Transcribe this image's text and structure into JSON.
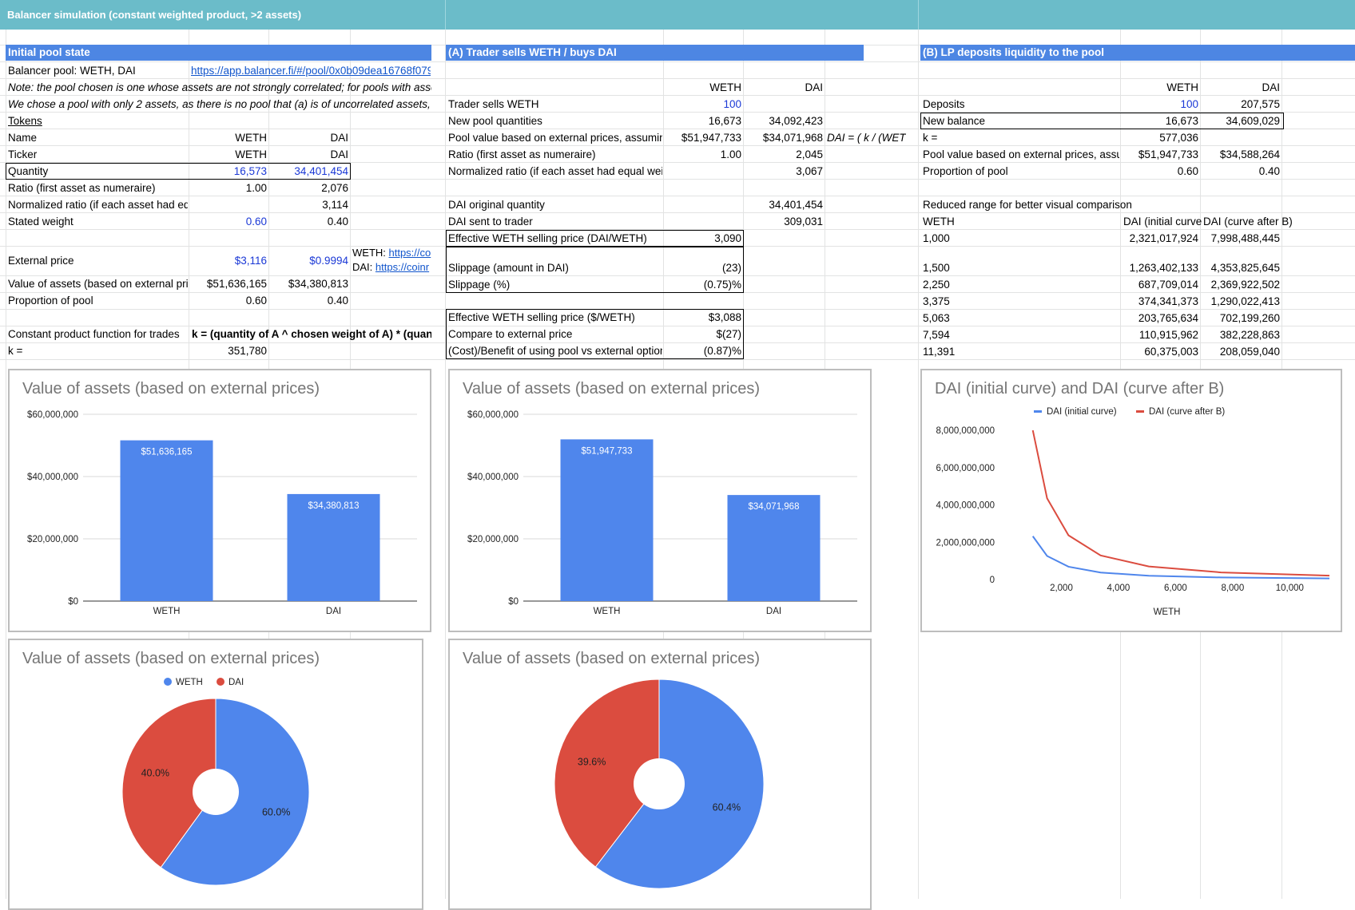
{
  "title": "Balancer simulation (constant weighted product, >2 assets)",
  "initial": {
    "header": "Initial pool state",
    "pool_label": "Balancer pool: WETH, DAI",
    "pool_link": "https://app.balancer.fi/#/pool/0x0b09dea16768f079",
    "note1": "Note: the pool chosen is one whose assets are not strongly correlated; for pools with asse",
    "note2": "We chose a pool with only 2 assets, as there is no pool that (a) is of uncorrelated assets, (",
    "tokens": "Tokens",
    "name_label": "Name",
    "name_a": "WETH",
    "name_b": "DAI",
    "ticker_label": "Ticker",
    "ticker_a": "WETH",
    "ticker_b": "DAI",
    "qty_label": "Quantity",
    "qty_a": "16,573",
    "qty_b": "34,401,454",
    "ratio_label": "Ratio (first asset as numeraire)",
    "ratio_a": "1.00",
    "ratio_b": "2,076",
    "norm_label": "Normalized ratio (if each asset had equ",
    "norm_b": "3,114",
    "weight_label": "Stated weight",
    "weight_a": "0.60",
    "weight_b": "0.40",
    "ext_label": "External price",
    "ext_a": "$3,116",
    "ext_b": "$0.9994",
    "ext_src_weth": "WETH: ",
    "ext_src_weth_link": "https://co",
    "ext_src_dai": "DAI: ",
    "ext_src_dai_link": "https://coinr",
    "value_label": "Value of assets (based on external pric",
    "value_a": "$51,636,165",
    "value_b": "$34,380,813",
    "prop_label": "Proportion of pool",
    "prop_a": "0.60",
    "prop_b": "0.40",
    "cpf_label": "Constant product function for trades",
    "cpf_formula": "k = (quantity of A ^ chosen weight of A) * (quan",
    "k_label": "k =",
    "k_value": "351,780"
  },
  "sectionA": {
    "header": "(A) Trader sells WETH / buys DAI",
    "col_a": "WETH",
    "col_b": "DAI",
    "sells_label": "Trader sells WETH",
    "sells_a": "100",
    "newq_label": "New pool quantities",
    "newq_a": "16,673",
    "newq_b": "34,092,423",
    "pv_label": "Pool value based on external prices, assumin",
    "pv_a": "$51,947,733",
    "pv_b": "$34,071,968",
    "pv_note": "DAI = ( k / (WET",
    "ratio_label": "Ratio (first asset as numeraire)",
    "ratio_a": "1.00",
    "ratio_b": "2,045",
    "norm_label": "Normalized ratio (if each asset had equal wei",
    "norm_b": "3,067",
    "dai_orig_label": "DAI original quantity",
    "dai_orig": "34,401,454",
    "dai_sent_label": "DAI sent to trader",
    "dai_sent": "309,031",
    "eff_label": "Effective WETH selling price (DAI/WETH)",
    "eff": "3,090",
    "slip_amt_label": "Slippage (amount in DAI)",
    "slip_amt": "(23)",
    "slip_pct_label": "Slippage (%)",
    "slip_pct": "(0.75)%",
    "eff_usd_label": "Effective WETH selling price ($/WETH)",
    "eff_usd": "$3,088",
    "cmp_label": "Compare to external price",
    "cmp": "$(27)",
    "cost_label": "(Cost)/Benefit of using pool vs external option",
    "cost": "(0.87)%"
  },
  "sectionB": {
    "header": "(B) LP deposits liquidity to the pool",
    "col_a": "WETH",
    "col_b": "DAI",
    "dep_label": "Deposits",
    "dep_a": "100",
    "dep_b": "207,575",
    "nb_label": "New balance",
    "nb_a": "16,673",
    "nb_b": "34,609,029",
    "k_label": "k =",
    "k_value": "577,036",
    "pv_label": "Pool value based on external prices, assu",
    "pv_a": "$51,947,733",
    "pv_b": "$34,588,264",
    "prop_label": "Proportion of pool",
    "prop_a": "0.60",
    "prop_b": "0.40",
    "range_label": "Reduced range for better visual comparison",
    "range_col_weth": "WETH",
    "range_col_init": "DAI (initial curve",
    "range_col_after": "DAI (curve after B)",
    "range_rows": [
      {
        "weth": "1,000",
        "init": "2,321,017,924",
        "after": "7,998,488,445"
      },
      {
        "weth": "1,500",
        "init": "1,263,402,133",
        "after": "4,353,825,645"
      },
      {
        "weth": "2,250",
        "init": "687,709,014",
        "after": "2,369,922,502"
      },
      {
        "weth": "3,375",
        "init": "374,341,373",
        "after": "1,290,022,413"
      },
      {
        "weth": "5,063",
        "init": "203,765,634",
        "after": "702,199,260"
      },
      {
        "weth": "7,594",
        "init": "110,915,962",
        "after": "382,228,863"
      },
      {
        "weth": "11,391",
        "init": "60,375,003",
        "after": "208,059,040"
      }
    ]
  },
  "colors": {
    "weth": "#4f86ec",
    "dai": "#db4c3f",
    "header": "#4d86e3",
    "title_bar": "#6bbcc9"
  },
  "chart_data": [
    {
      "type": "bar",
      "title": "Value of assets (based on external prices)",
      "categories": [
        "WETH",
        "DAI"
      ],
      "values": [
        51636165,
        34380813
      ],
      "labels": [
        "$51,636,165",
        "$34,380,813"
      ],
      "yticks": [
        "$60,000,000",
        "$40,000,000",
        "$20,000,000",
        "$0"
      ],
      "ylim": [
        0,
        60000000
      ]
    },
    {
      "type": "bar",
      "title": "Value of assets (based on external prices)",
      "categories": [
        "WETH",
        "DAI"
      ],
      "values": [
        51947733,
        34071968
      ],
      "labels": [
        "$51,947,733",
        "$34,071,968"
      ],
      "yticks": [
        "$60,000,000",
        "$40,000,000",
        "$20,000,000",
        "$0"
      ],
      "ylim": [
        0,
        60000000
      ]
    },
    {
      "type": "line",
      "title": "DAI (initial curve) and DAI (curve after B)",
      "xlabel": "WETH",
      "x": [
        1000,
        1500,
        2250,
        3375,
        5063,
        7594,
        11391
      ],
      "series": [
        {
          "name": "DAI (initial curve)",
          "values": [
            2321017924,
            1263402133,
            687709014,
            374341373,
            203765634,
            110915962,
            60375003
          ]
        },
        {
          "name": "DAI (curve after B)",
          "values": [
            7998488445,
            4353825645,
            2369922502,
            1290022413,
            702199260,
            382228863,
            208059040
          ]
        }
      ],
      "xticks": [
        "2,000",
        "4,000",
        "6,000",
        "8,000",
        "10,000"
      ],
      "yticks": [
        "8,000,000,000",
        "6,000,000,000",
        "4,000,000,000",
        "2,000,000,000",
        "0"
      ],
      "xlim": [
        0,
        11391
      ],
      "ylim": [
        0,
        8000000000
      ],
      "legend": "top"
    },
    {
      "type": "pie",
      "title": "Value of assets (based on external prices)",
      "legend": [
        "WETH",
        "DAI"
      ],
      "values": [
        60.0,
        40.0
      ],
      "labels": [
        "60.0%",
        "40.0%"
      ]
    },
    {
      "type": "pie",
      "title": "Value of assets (based on external prices)",
      "values": [
        60.4,
        39.6
      ],
      "labels": [
        "60.4%",
        "39.6%"
      ]
    }
  ]
}
